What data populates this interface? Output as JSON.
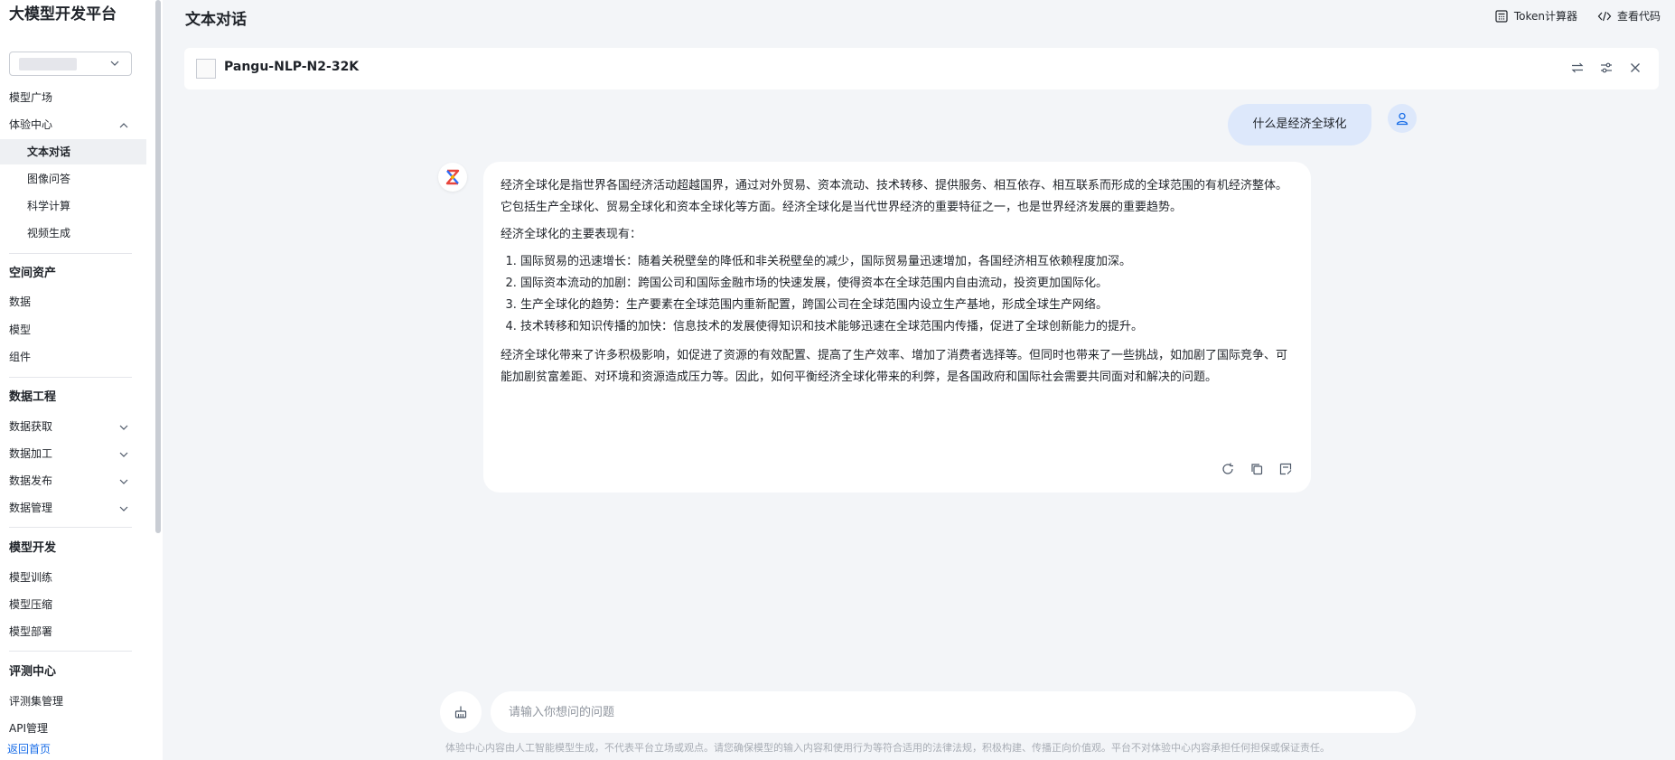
{
  "sidebar": {
    "brand": "大模型开发平台",
    "nav": {
      "model_square": "模型广场",
      "experience_center": "体验中心",
      "text_chat": "文本对话",
      "image_qa": "图像问答",
      "science_calc": "科学计算",
      "video_gen": "视频生成",
      "space_assets": "空间资产",
      "data": "数据",
      "model": "模型",
      "component": "组件",
      "data_engineering": "数据工程",
      "data_acquire": "数据获取",
      "data_process": "数据加工",
      "data_publish": "数据发布",
      "data_manage": "数据管理",
      "model_dev": "模型开发",
      "model_train": "模型训练",
      "model_compress": "模型压缩",
      "model_deploy": "模型部署",
      "eval_center": "评测中心",
      "eval_set_manage": "评测集管理",
      "api_manage": "API管理"
    },
    "back_home": "返回首页"
  },
  "header": {
    "title": "文本对话",
    "token_calc": "Token计算器",
    "view_code": "查看代码"
  },
  "model_bar": {
    "name": "Pangu-NLP-N2-32K"
  },
  "chat": {
    "user_message": "什么是经济全球化",
    "answer": {
      "p1": "经济全球化是指世界各国经济活动超越国界，通过对外贸易、资本流动、技术转移、提供服务、相互依存、相互联系而形成的全球范围的有机经济整体。它包括生产全球化、贸易全球化和资本全球化等方面。经济全球化是当代世界经济的重要特征之一，也是世界经济发展的重要趋势。",
      "p2": "经济全球化的主要表现有：",
      "items": [
        "国际贸易的迅速增长：随着关税壁垒的降低和非关税壁垒的减少，国际贸易量迅速增加，各国经济相互依赖程度加深。",
        "国际资本流动的加剧：跨国公司和国际金融市场的快速发展，使得资本在全球范围内自由流动，投资更加国际化。",
        "生产全球化的趋势：生产要素在全球范围内重新配置，跨国公司在全球范围内设立生产基地，形成全球生产网络。",
        "技术转移和知识传播的加快：信息技术的发展使得知识和技术能够迅速在全球范围内传播，促进了全球创新能力的提升。"
      ],
      "p3": "经济全球化带来了许多积极影响，如促进了资源的有效配置、提高了生产效率、增加了消费者选择等。但同时也带来了一些挑战，如加剧了国际竞争、可能加剧贫富差距、对环境和资源造成压力等。因此，如何平衡经济全球化带来的利弊，是各国政府和国际社会需要共同面对和解决的问题。"
    }
  },
  "input": {
    "placeholder": "请输入你想问的问题"
  },
  "footer": {
    "disclaimer": "体验中心内容由人工智能模型生成，不代表平台立场或观点。请您确保模型的输入内容和使用行为等符合适用的法律法规，积极构建、传播正向价值观。平台不对体验中心内容承担任何担保或保证责任。"
  },
  "icons": {
    "chevron": "chevron-down-icon",
    "token": "calculator-icon",
    "code": "code-icon",
    "switch": "swap-icon",
    "settings": "sliders-icon",
    "close": "close-icon",
    "user": "user-icon",
    "bot": "pangu-logo-icon",
    "refresh": "refresh-icon",
    "copy": "copy-icon",
    "feedback": "feedback-icon",
    "clear": "broom-icon"
  },
  "colors": {
    "accent": "#1a6ee8",
    "user_bubble": "#dde8fb",
    "background": "#f3f5f8"
  }
}
